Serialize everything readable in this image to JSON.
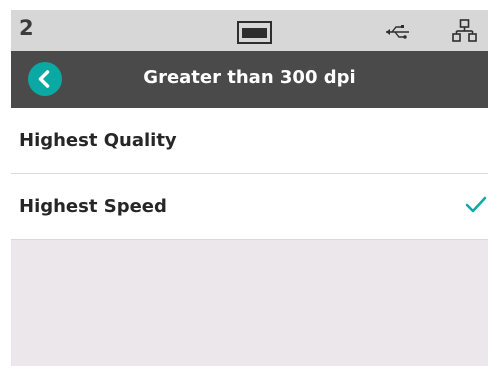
{
  "status_bar": {
    "number": "2",
    "icons": [
      "output-tray-icon",
      "usb-icon",
      "network-icon"
    ]
  },
  "header": {
    "back_icon": "chevron-left-icon",
    "title": "Greater than 300 dpi"
  },
  "options": [
    {
      "label": "Highest Quality",
      "selected": false
    },
    {
      "label": "Highest Speed",
      "selected": true
    }
  ],
  "colors": {
    "accent": "#0ba9a3",
    "header_bg": "#4a4a4a",
    "status_bg": "#d7d7d7",
    "screen_bg": "#ece7ea"
  }
}
